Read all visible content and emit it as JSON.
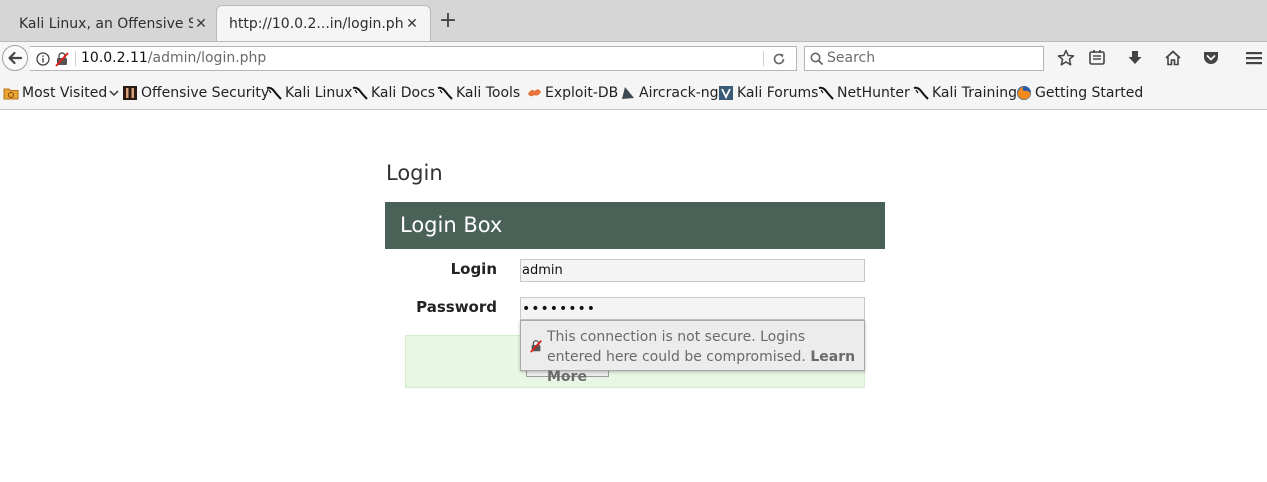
{
  "tabs": [
    {
      "title": "Kali Linux, an Offensive S...",
      "active": false
    },
    {
      "title": "http://10.0.2...in/login.php",
      "active": true
    }
  ],
  "toolbar": {
    "url_host": "10.0.2.11",
    "url_path": "/admin/login.php",
    "search_placeholder": "Search"
  },
  "bookmarks": [
    {
      "label": "Most Visited",
      "icon": "most-visited-icon"
    },
    {
      "label": "Offensive Security",
      "icon": "offsec-icon"
    },
    {
      "label": "Kali Linux",
      "icon": "kali-dragon-icon"
    },
    {
      "label": "Kali Docs",
      "icon": "kali-dragon-icon"
    },
    {
      "label": "Kali Tools",
      "icon": "kali-dragon-icon"
    },
    {
      "label": "Exploit-DB",
      "icon": "exploit-db-icon"
    },
    {
      "label": "Aircrack-ng",
      "icon": "aircrack-icon"
    },
    {
      "label": "Kali Forums",
      "icon": "kali-forums-icon"
    },
    {
      "label": "NetHunter",
      "icon": "kali-dragon-icon"
    },
    {
      "label": "Kali Training",
      "icon": "kali-dragon-icon"
    },
    {
      "label": "Getting Started",
      "icon": "firefox-icon"
    }
  ],
  "page": {
    "title": "Login",
    "box_title": "Login Box",
    "login_label": "Login",
    "login_value": "admin",
    "password_label": "Password",
    "password_masked": "••••••••"
  },
  "popup": {
    "message": "This connection is not secure. Logins entered here could be compromised.",
    "learn_more": "Learn More"
  },
  "colors": {
    "box_header": "#4a6157",
    "submit_area": "#e8f7e3"
  }
}
